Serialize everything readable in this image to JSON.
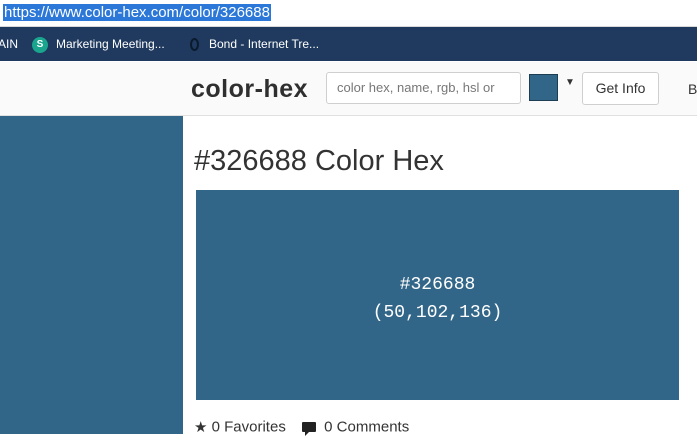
{
  "browser": {
    "url": "https://www.color-hex.com/color/326688"
  },
  "bookmarks": {
    "items": [
      {
        "label": "AIN"
      },
      {
        "label": "Marketing Meeting...",
        "icon": "sharepoint-icon",
        "icon_letter": "S"
      },
      {
        "label": "Bond - Internet Tre...",
        "icon": "opera-icon"
      }
    ]
  },
  "header": {
    "logo": "color-hex",
    "search_placeholder": "color hex, name, rgb, hsl or",
    "swatch_color": "#326688",
    "get_info_label": "Get Info",
    "truncated_nav": "B"
  },
  "content": {
    "title": "#326688 Color Hex",
    "hex": "#326688",
    "rgb": "(50,102,136)",
    "favorites": "0 Favorites",
    "comments": "0 Comments"
  },
  "colors": {
    "main": "#326688",
    "bookmarks_bar": "#1f3a5e"
  }
}
